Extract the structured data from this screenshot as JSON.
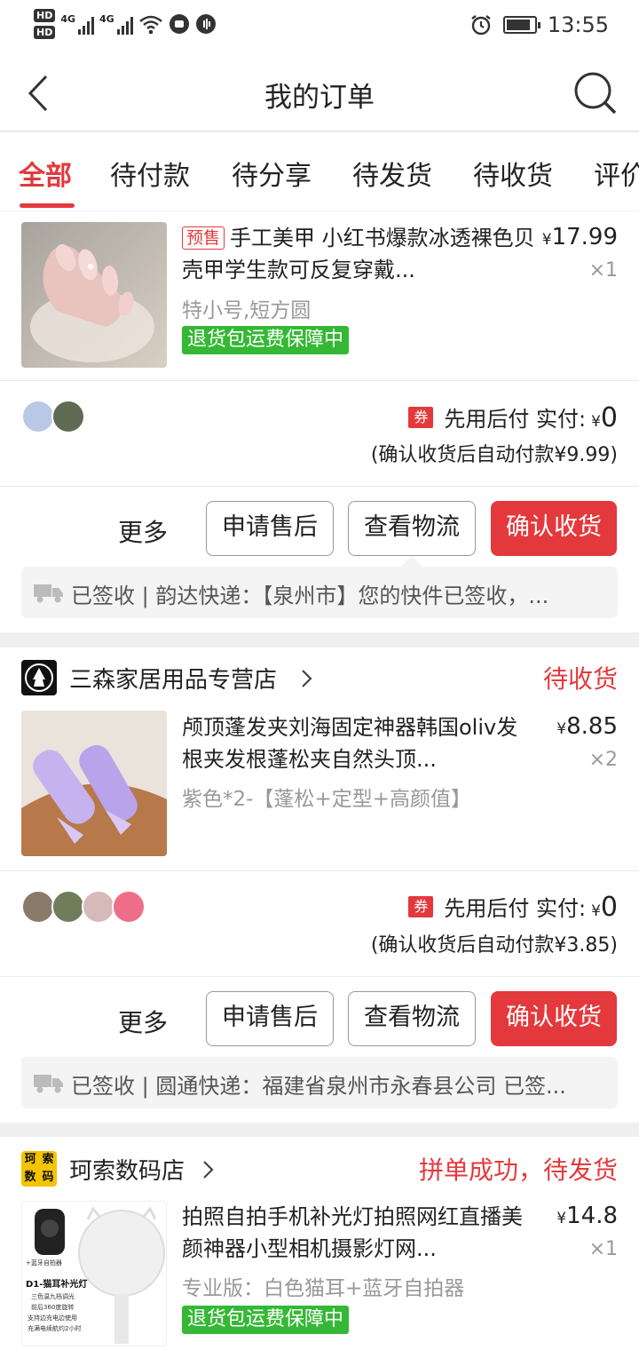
{
  "status_bar": {
    "time": "13:55",
    "hd1": "HD",
    "hd2": "HD",
    "net1": "4G",
    "net2": "4G"
  },
  "header": {
    "title": "我的订单"
  },
  "tabs": [
    "全部",
    "待付款",
    "待分享",
    "待发货",
    "待收货",
    "评价"
  ],
  "orders": [
    {
      "store": null,
      "product": {
        "presale_tag": "预售",
        "title": "手工美甲 小红书爆款冰透裸色贝壳甲学生款可反复穿戴...",
        "price_symbol": "¥",
        "price": "17.99",
        "qty": "×1",
        "spec": "特小号,短方圆",
        "badge": "退货包运费保障中"
      },
      "payment": {
        "coupon": "券",
        "label": "先用后付 实付:",
        "yen": "¥",
        "amount": "0",
        "auto_pay": "(确认收货后自动付款¥9.99)"
      },
      "actions": {
        "more": "更多",
        "after_sale": "申请售后",
        "logistics": "查看物流",
        "confirm": "确认收货"
      },
      "logistics_text": "已签收 | 韵达快递：【泉州市】您的快件已签收，..."
    },
    {
      "store": {
        "name": "三森家居用品专营店",
        "status": "待收货"
      },
      "product": {
        "title": "颅顶蓬发夹刘海固定神器韩国oliv发根夹发根蓬松夹自然头顶...",
        "price_symbol": "¥",
        "price": "8.85",
        "qty": "×2",
        "spec": "紫色*2-【蓬松+定型+高颜值】"
      },
      "payment": {
        "coupon": "券",
        "label": "先用后付 实付:",
        "yen": "¥",
        "amount": "0",
        "auto_pay": "(确认收货后自动付款¥3.85)"
      },
      "actions": {
        "more": "更多",
        "after_sale": "申请售后",
        "logistics": "查看物流",
        "confirm": "确认收货"
      },
      "logistics_text": "已签收 | 圆通快递：福建省泉州市永春县公司 已签..."
    },
    {
      "store": {
        "name": "珂索数码店",
        "status": "拼单成功，待发货",
        "logo_text": "珂索数码"
      },
      "product": {
        "title": "拍照自拍手机补光灯拍照网红直播美颜神器小型相机摄影灯网...",
        "price_symbol": "¥",
        "price": "14.8",
        "qty": "×1",
        "spec": "专业版：白色猫耳+蓝牙自拍器",
        "badge": "退货包运费保障中",
        "thumb_text": [
          "+蓝牙自拍器",
          "D1-猫耳补光灯",
          "三色温九档调光",
          "前后360度旋转",
          "支持边充电边使用",
          "充满电续航约2小时"
        ]
      }
    }
  ],
  "colors": {
    "accent": "#e4393c",
    "badge_green": "#35b835"
  }
}
